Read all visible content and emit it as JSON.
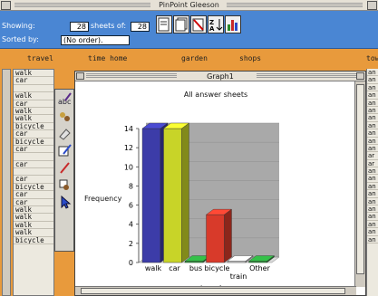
{
  "window": {
    "title": "PinPoint Gleeson"
  },
  "toolbar": {
    "showing_label": "Showing:",
    "showing_value": "28",
    "sheets_of_label": "sheets of:",
    "sheets_total": "28",
    "sorted_label": "Sorted by:",
    "sorted_value": "(No order)."
  },
  "sheet": {
    "columns": [
      "travel",
      "time home",
      "garden",
      "shops",
      "tow"
    ],
    "rows": [
      "walk",
      "car",
      "",
      "walk",
      "car",
      "walk",
      "walk",
      "bicycle",
      "car",
      "bicycle",
      "car",
      "",
      "car",
      "",
      "car",
      "bicycle",
      "car",
      "car",
      "walk",
      "walk",
      "walk",
      "walk",
      "bicycle"
    ],
    "right_rows": [
      "an",
      "an",
      "an",
      "an",
      "an",
      "an",
      "an",
      "an",
      "an",
      "an",
      "an",
      "ar",
      "ar",
      "an",
      "an",
      "an",
      "an",
      "an",
      "an",
      "an",
      "an",
      "an",
      "an"
    ]
  },
  "graph": {
    "window_title": "Graph1",
    "title": "All answer sheets",
    "ylabel": "Frequency",
    "xlabel": "travel"
  },
  "chart_data": {
    "type": "bar",
    "title": "All answer sheets",
    "xlabel": "travel",
    "ylabel": "Frequency",
    "categories": [
      "walk",
      "car",
      "bus",
      "bicycle",
      "train",
      "Other"
    ],
    "values": [
      14,
      14,
      0,
      5,
      0,
      0
    ],
    "ylim": [
      0,
      14
    ],
    "yticks": [
      0,
      2,
      4,
      6,
      8,
      10,
      12,
      14
    ],
    "colors": [
      "#3c3ca8",
      "#c8d428",
      "#2a9a3a",
      "#d83a2a",
      "#cfcfcf",
      "#2a9a3a"
    ]
  }
}
